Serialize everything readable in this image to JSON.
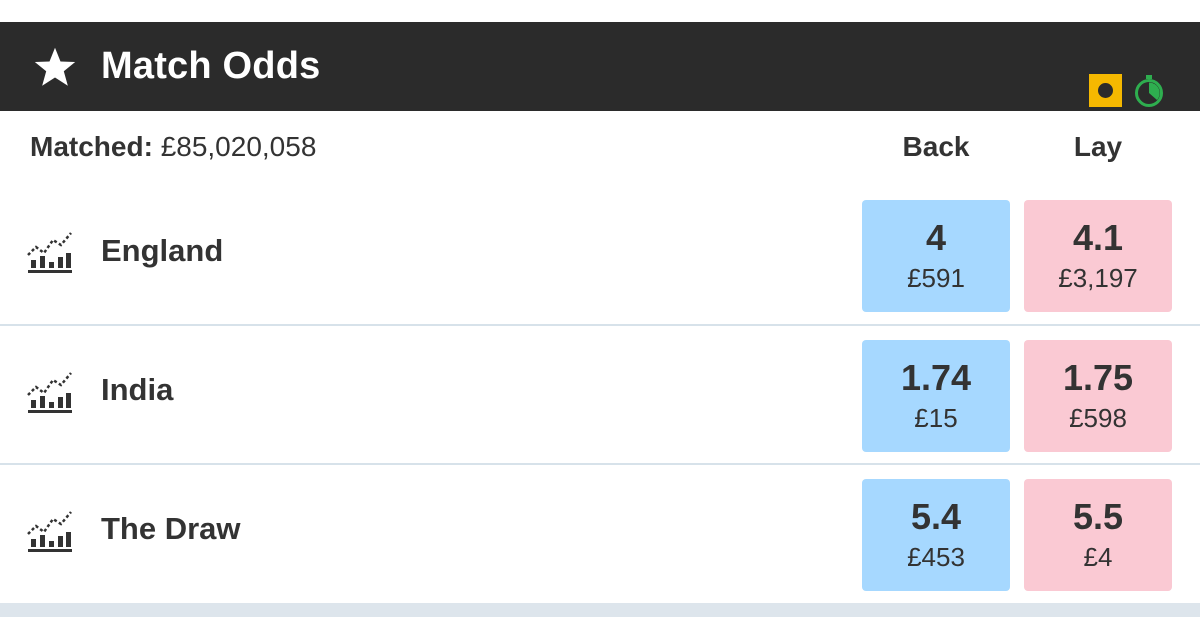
{
  "market": {
    "title": "Match Odds",
    "icons": [
      "star-icon",
      "in-play-icon",
      "timer-icon"
    ]
  },
  "summary": {
    "matched_label": "Matched:",
    "matched_value": "£85,020,058",
    "back_header": "Back",
    "lay_header": "Lay"
  },
  "runners": [
    {
      "name": "England",
      "back": {
        "odds": "4",
        "stake": "£591"
      },
      "lay": {
        "odds": "4.1",
        "stake": "£3,197"
      }
    },
    {
      "name": "India",
      "back": {
        "odds": "1.74",
        "stake": "£15"
      },
      "lay": {
        "odds": "1.75",
        "stake": "£598"
      }
    },
    {
      "name": "The Draw",
      "back": {
        "odds": "5.4",
        "stake": "£453"
      },
      "lay": {
        "odds": "5.5",
        "stake": "£4"
      }
    }
  ],
  "colors": {
    "header_bg": "#2b2b2b",
    "back_bg": "#a6d8ff",
    "lay_bg": "#fac9d3",
    "in_play_yellow": "#f5b800",
    "timer_green": "#2eae4f",
    "divider": "#d7e2ea"
  }
}
